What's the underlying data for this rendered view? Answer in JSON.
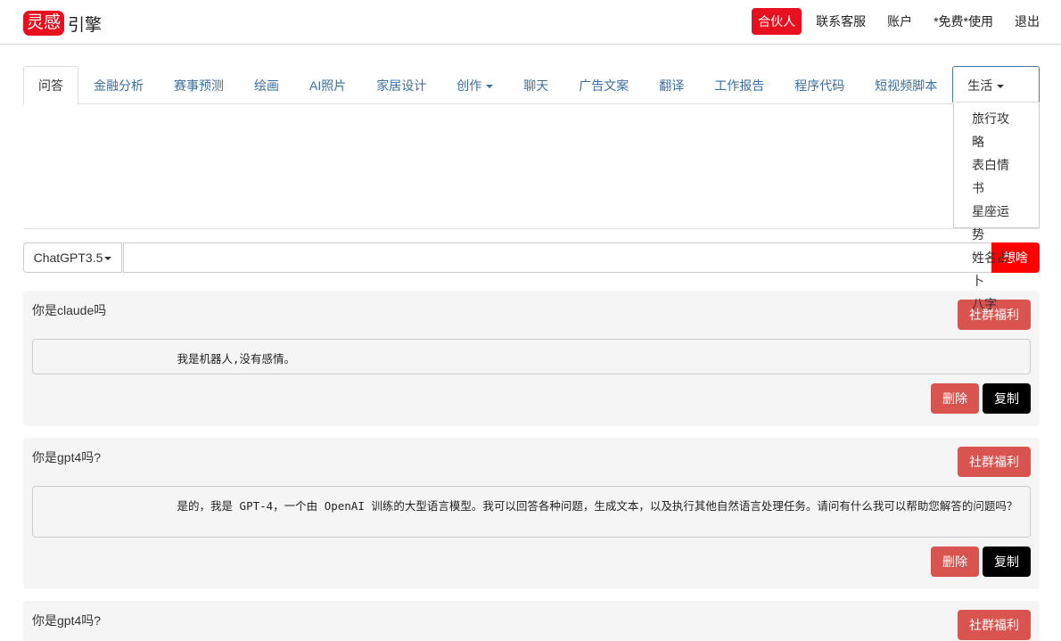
{
  "brand": {
    "badge": "灵感",
    "rest": "引擎"
  },
  "topnav": {
    "partner": "合伙人",
    "support": "联系客服",
    "account": "账户",
    "free": "*免费*使用",
    "logout": "退出"
  },
  "tabs": [
    {
      "label": "问答"
    },
    {
      "label": "金融分析"
    },
    {
      "label": "赛事预测"
    },
    {
      "label": "绘画"
    },
    {
      "label": "AI照片"
    },
    {
      "label": "家居设计"
    },
    {
      "label": "创作"
    },
    {
      "label": "聊天"
    },
    {
      "label": "广告文案"
    },
    {
      "label": "翻译"
    },
    {
      "label": "工作报告"
    },
    {
      "label": "程序代码"
    },
    {
      "label": "短视频脚本"
    },
    {
      "label": "生活"
    }
  ],
  "life_menu": [
    "旅行攻略",
    "表白情书",
    "星座运势",
    "姓名占卜",
    "八字"
  ],
  "query": {
    "model": "ChatGPT3.5",
    "value": "",
    "submit": "想啥"
  },
  "cards": [
    {
      "question": "你是claude吗",
      "answer": "                    我是机器人,没有感情。",
      "welfare": "社群福利",
      "delete": "删除",
      "copy": "复制"
    },
    {
      "question": "你是gpt4吗?",
      "answer": "                    是的，我是 GPT-4，一个由 OpenAI 训练的大型语言模型。我可以回答各种问题，生成文本，以及执行其他自然语言处理任务。请问有什么我可以帮助您解答的问题吗？",
      "welfare": "社群福利",
      "delete": "删除",
      "copy": "复制"
    },
    {
      "question": "你是gpt4吗?",
      "welfare": "社群福利"
    }
  ],
  "colors": {
    "brand_red": "#e8101e",
    "submit_red": "#ff0000",
    "danger": "#d9534f",
    "tab_link": "#3b6fa0"
  }
}
